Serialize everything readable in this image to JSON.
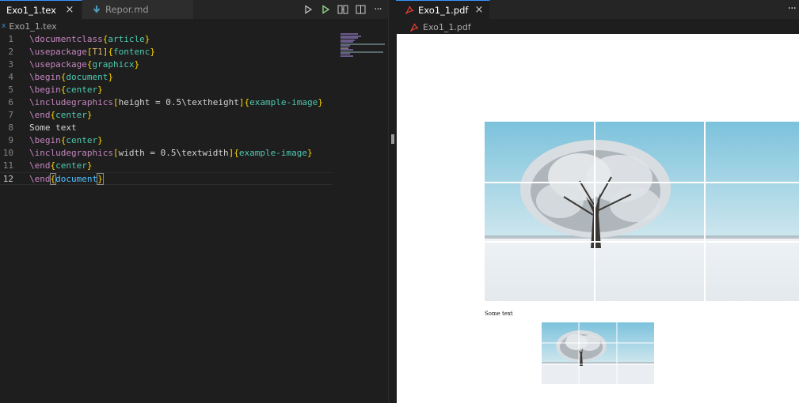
{
  "editor": {
    "tabs": [
      {
        "label": "Exo1_1.tex",
        "active": true,
        "close": "×"
      },
      {
        "label": "Repor.md",
        "active": false
      }
    ],
    "breadcrumb": {
      "icon_text": "x",
      "file": "Exo1_1.tex"
    },
    "lines": [
      {
        "n": "1"
      },
      {
        "n": "2"
      },
      {
        "n": "3"
      },
      {
        "n": "4"
      },
      {
        "n": "5"
      },
      {
        "n": "6"
      },
      {
        "n": "7"
      },
      {
        "n": "8"
      },
      {
        "n": "9"
      },
      {
        "n": "10"
      },
      {
        "n": "11"
      },
      {
        "n": "12"
      }
    ],
    "code": {
      "l1": {
        "cmd": "\\documentclass",
        "arg": "article"
      },
      "l2": {
        "cmd": "\\usepackage",
        "opt": "T1",
        "arg": "fontenc"
      },
      "l3": {
        "cmd": "\\usepackage",
        "arg": "graphicx"
      },
      "l4": {
        "cmd": "\\begin",
        "arg": "document"
      },
      "l5": {
        "cmd": "\\begin",
        "arg": "center"
      },
      "l6": {
        "cmd": "\\includegraphics",
        "opt": "height = 0.5\\textheight",
        "arg": "example-image"
      },
      "l7": {
        "cmd": "\\end",
        "arg": "center"
      },
      "l8": {
        "text": "Some text"
      },
      "l9": {
        "cmd": "\\begin",
        "arg": "center"
      },
      "l10": {
        "cmd": "\\includegraphics",
        "opt": "width = 0.5\\textwidth",
        "arg": "example-image"
      },
      "l11": {
        "cmd": "\\end",
        "arg": "center"
      },
      "l12": {
        "cmd": "\\end",
        "arg": "document"
      }
    },
    "current_line": 12
  },
  "pdf_viewer": {
    "tab": {
      "label": "Exo1_1.pdf",
      "close": "×"
    },
    "more": "···",
    "breadcrumb": "Exo1_1.pdf",
    "content": {
      "text": "Some text"
    }
  },
  "colors": {
    "accent": "#3794ff",
    "pdf_icon": "#e03c31",
    "run_green": "#89d185"
  }
}
